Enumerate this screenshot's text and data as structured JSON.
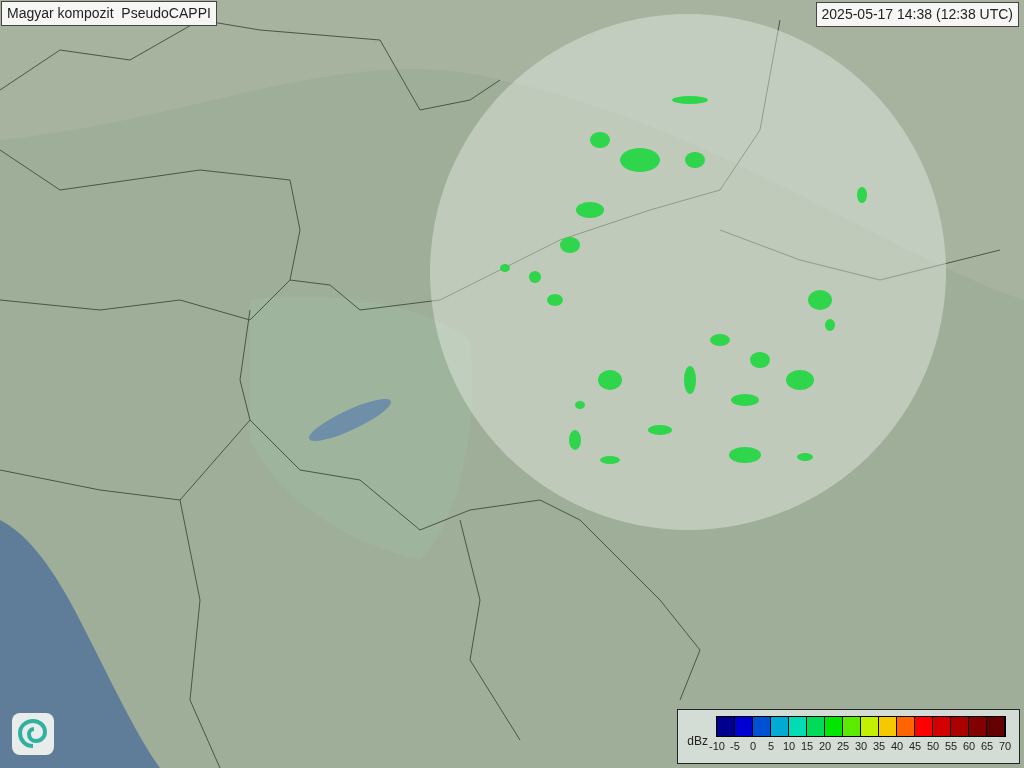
{
  "title": "Magyar kompozit  PseudoCAPPI",
  "timestamp": "2025-05-17 14:38 (12:38 UTC)",
  "legend": {
    "unit": "dBz",
    "swatches": [
      {
        "color": "#00008c"
      },
      {
        "color": "#0000d2"
      },
      {
        "color": "#0050d2"
      },
      {
        "color": "#00aad2"
      },
      {
        "color": "#00dcb4"
      },
      {
        "color": "#00dc5a"
      },
      {
        "color": "#00e600"
      },
      {
        "color": "#5aeb00"
      },
      {
        "color": "#c3f000"
      },
      {
        "color": "#f5c800"
      },
      {
        "color": "#ff6400"
      },
      {
        "color": "#ff0000"
      },
      {
        "color": "#d20000"
      },
      {
        "color": "#aa0000"
      },
      {
        "color": "#820000"
      },
      {
        "color": "#640000"
      }
    ],
    "ticks": [
      "-10",
      "-5",
      "0",
      "5",
      "10",
      "15",
      "20",
      "25",
      "30",
      "35",
      "40",
      "45",
      "50",
      "55",
      "60",
      "65",
      "70"
    ]
  }
}
